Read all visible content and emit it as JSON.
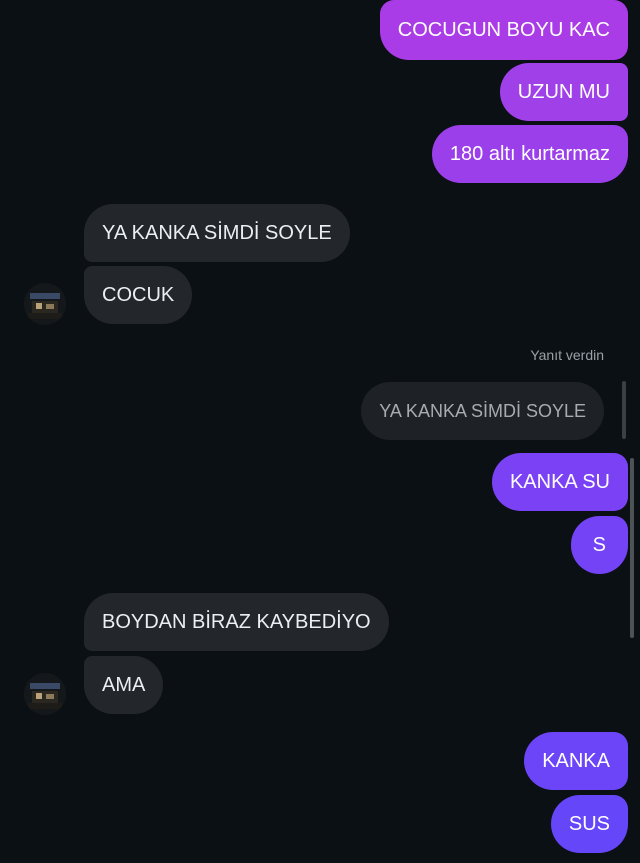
{
  "messages": {
    "m1": "COCUGUN BOYU KAC",
    "m2": "UZUN MU",
    "m3": "180 altı kurtarmaz",
    "m4": "YA KANKA SİMDİ SOYLE",
    "m5": "COCUK",
    "m6": "KANKA SU",
    "m7": "S",
    "m8": "BOYDAN BİRAZ KAYBEDİYO",
    "m9": "AMA",
    "m10": "KANKA",
    "m11": "SUS"
  },
  "reply": {
    "label": "Yanıt verdin",
    "quoted_text": "YA KANKA SİMDİ SOYLE"
  },
  "colors": {
    "background": "#0b1014",
    "sent_bubble_purple": "#a93ce6",
    "sent_bubble_violet": "#7b42f5",
    "received_bubble": "#23272b"
  }
}
